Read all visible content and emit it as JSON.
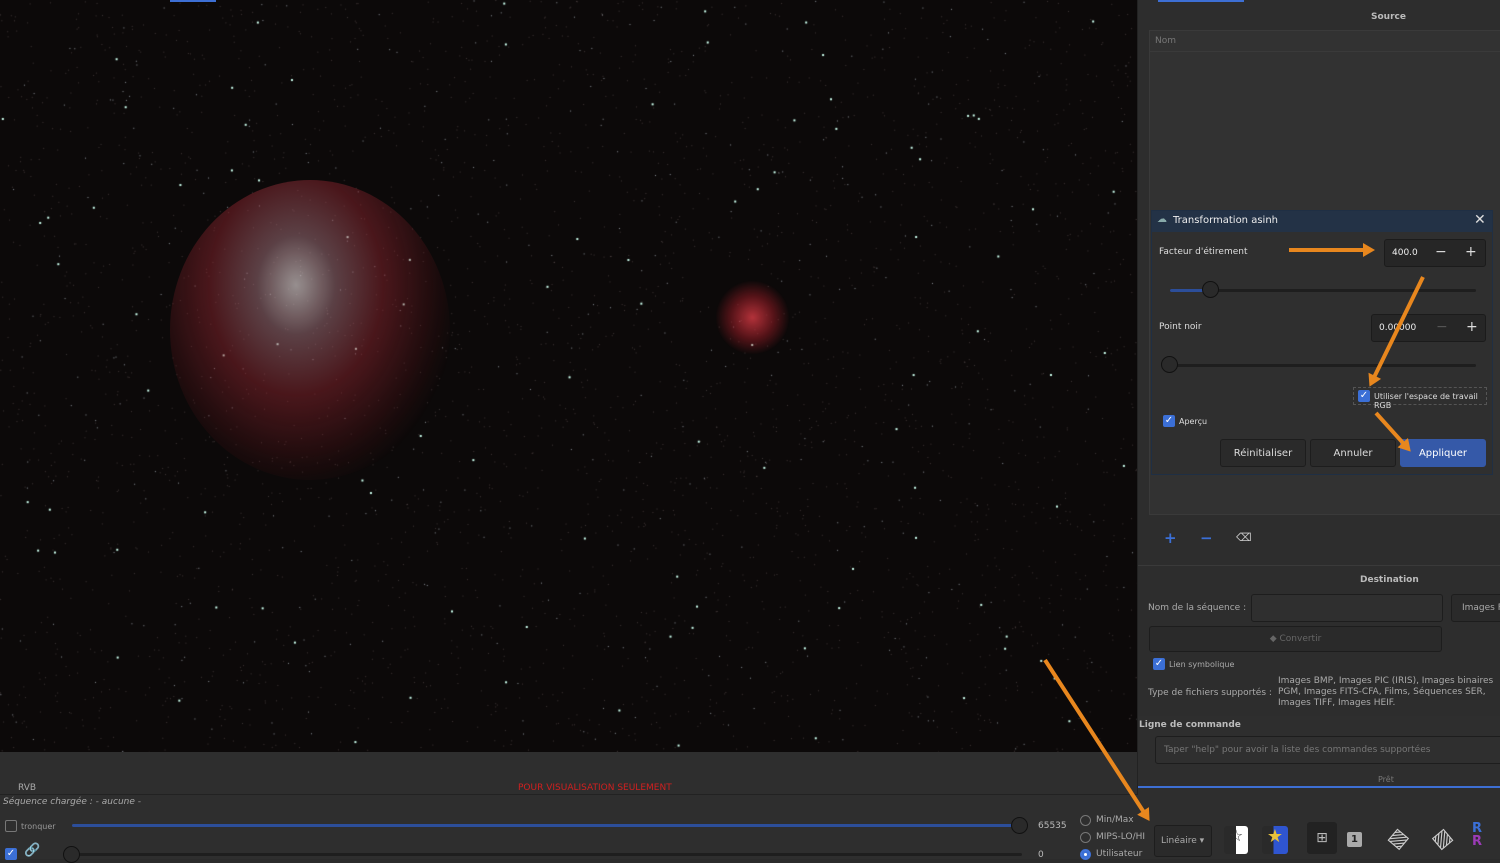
{
  "image": {
    "channel": "RVB",
    "preview_notice": "POUR VISUALISATION SEULEMENT"
  },
  "sequence": {
    "loaded_label": "Séquence chargée : - aucune -"
  },
  "histogram": {
    "truncate_label": "tronquer",
    "truncate_checked": false,
    "high_value": "65535",
    "low_value": "0",
    "link_checked": true,
    "modes": [
      {
        "label": "Min/Max",
        "selected": false
      },
      {
        "label": "MIPS-LO/HI",
        "selected": false
      },
      {
        "label": "Utilisateur",
        "selected": true
      }
    ],
    "scale": "Linéaire"
  },
  "source": {
    "title": "Source",
    "column_name": "Nom"
  },
  "dialog": {
    "title": "Transformation asinh",
    "stretch_label": "Facteur d'étirement",
    "stretch_value": "400.0",
    "stretch_slider": 0.13,
    "black_label": "Point noir",
    "black_value": "0.00000",
    "black_slider": 0,
    "rgb_label": "Utiliser l'espace de travail RGB",
    "rgb_checked": true,
    "preview_label": "Aperçu",
    "preview_checked": true,
    "reset": "Réinitialiser",
    "cancel": "Annuler",
    "apply": "Appliquer",
    "minus": "−",
    "plus": "+"
  },
  "destination": {
    "title": "Destination",
    "seq_name_label": "Nom de la séquence :",
    "seq_name_value": "",
    "format": "Images F",
    "convert": "Convertir",
    "symlink_label": "Lien symbolique",
    "symlink_checked": true,
    "filetypes_label": "Type de fichiers supportés :",
    "filetypes": "Images BMP, Images PIC (IRIS), Images binaires PGM, Images FITS-CFA, Films, Séquences SER, Images TIFF, Images HEIF."
  },
  "command": {
    "title": "Ligne de commande",
    "placeholder": "Taper \"help\" pour avoir la liste des commandes supportées",
    "status": "Prêt"
  },
  "colors": {
    "accent": "#3b6fd6",
    "annotation": "#e8871e",
    "notice": "#d02020"
  }
}
